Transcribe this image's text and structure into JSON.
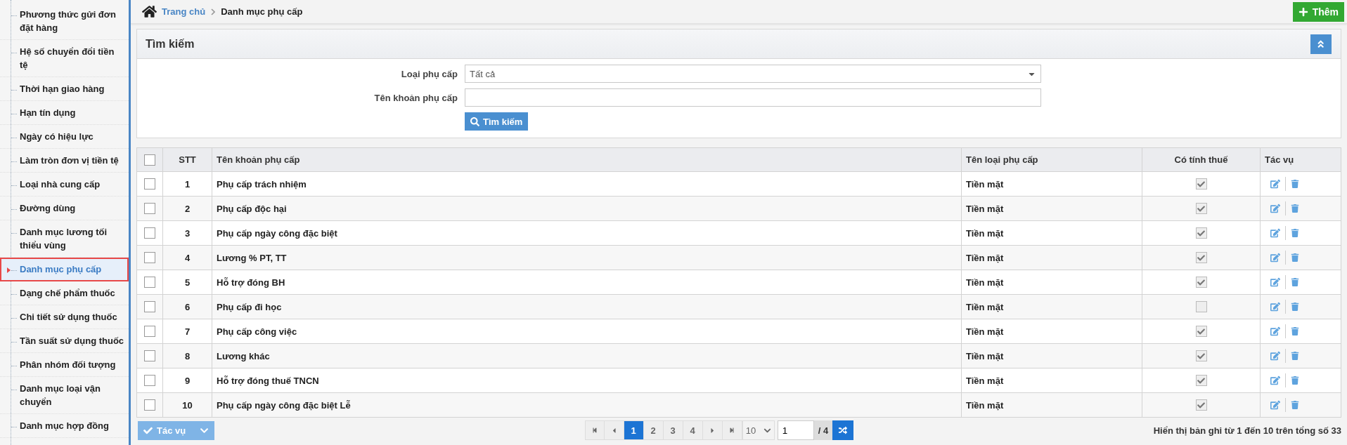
{
  "sidebar": {
    "items": [
      {
        "label": "Phương thức gửi đơn đặt hàng",
        "selected": false
      },
      {
        "label": "Hệ số chuyển đổi tiền tệ",
        "selected": false
      },
      {
        "label": "Thời hạn giao hàng",
        "selected": false
      },
      {
        "label": "Hạn tín dụng",
        "selected": false
      },
      {
        "label": "Ngày có hiệu lực",
        "selected": false
      },
      {
        "label": "Làm tròn đơn vị tiền tệ",
        "selected": false
      },
      {
        "label": "Loại nhà cung cấp",
        "selected": false
      },
      {
        "label": "Đường dùng",
        "selected": false
      },
      {
        "label": "Danh mục lương tối thiểu vùng",
        "selected": false
      },
      {
        "label": "Danh mục phụ cấp",
        "selected": true
      },
      {
        "label": "Dạng chế phẩm thuốc",
        "selected": false
      },
      {
        "label": "Chi tiết sử dụng thuốc",
        "selected": false
      },
      {
        "label": "Tần suất sử dụng thuốc",
        "selected": false
      },
      {
        "label": "Phân nhóm đối tượng",
        "selected": false
      },
      {
        "label": "Danh mục loại vận chuyển",
        "selected": false
      },
      {
        "label": "Danh mục hợp đồng",
        "selected": false
      }
    ]
  },
  "breadcrumb": {
    "home": "Trang chủ",
    "current": "Danh mục phụ cấp"
  },
  "add_button": "Thêm",
  "search_panel": {
    "title": "Tìm kiếm",
    "fields": [
      {
        "kind": "select",
        "label": "Loại phụ cấp",
        "value": "Tất cả"
      },
      {
        "kind": "text",
        "label": "Tên khoản phụ cấp"
      }
    ],
    "button": "Tìm kiếm"
  },
  "table": {
    "select_all": {
      "checked": false
    },
    "columns": [
      "STT",
      "Tên khoản phụ cấp",
      "Tên loại phụ cấp",
      "Có tính thuế",
      "Tác vụ"
    ],
    "rows": [
      {
        "stt": "1",
        "name": "Phụ cấp trách nhiệm",
        "type": "Tiền mặt",
        "taxable": true,
        "checked": false
      },
      {
        "stt": "2",
        "name": "Phụ cấp độc hại",
        "type": "Tiền mặt",
        "taxable": true,
        "checked": false
      },
      {
        "stt": "3",
        "name": "Phụ cấp ngày công đặc biệt",
        "type": "Tiền mặt",
        "taxable": true,
        "checked": false
      },
      {
        "stt": "4",
        "name": "Lương % PT, TT",
        "type": "Tiền mặt",
        "taxable": true,
        "checked": false
      },
      {
        "stt": "5",
        "name": "Hỗ trợ đóng BH",
        "type": "Tiền mặt",
        "taxable": true,
        "checked": false
      },
      {
        "stt": "6",
        "name": "Phụ cấp đi học",
        "type": "Tiền mặt",
        "taxable": false,
        "checked": false
      },
      {
        "stt": "7",
        "name": "Phụ cấp công việc",
        "type": "Tiền mặt",
        "taxable": true,
        "checked": false
      },
      {
        "stt": "8",
        "name": "Lương khác",
        "type": "Tiền mặt",
        "taxable": true,
        "checked": false
      },
      {
        "stt": "9",
        "name": "Hỗ trợ đóng thuế TNCN",
        "type": "Tiền mặt",
        "taxable": true,
        "checked": false
      },
      {
        "stt": "10",
        "name": "Phụ cấp ngày công đặc biệt Lễ",
        "type": "Tiền mặt",
        "taxable": true,
        "checked": false
      }
    ]
  },
  "footer": {
    "bulk_action": "Tác vụ",
    "pagination": {
      "pages": [
        {
          "label": "1",
          "selected": true
        },
        {
          "label": "2",
          "selected": false
        },
        {
          "label": "3",
          "selected": false
        },
        {
          "label": "4",
          "selected": false
        }
      ],
      "page_size": "10",
      "page_input": "1",
      "page_total": "/ 4"
    },
    "summary": "Hiển thị bản ghi từ 1 đến 10 trên tổng số 33"
  }
}
